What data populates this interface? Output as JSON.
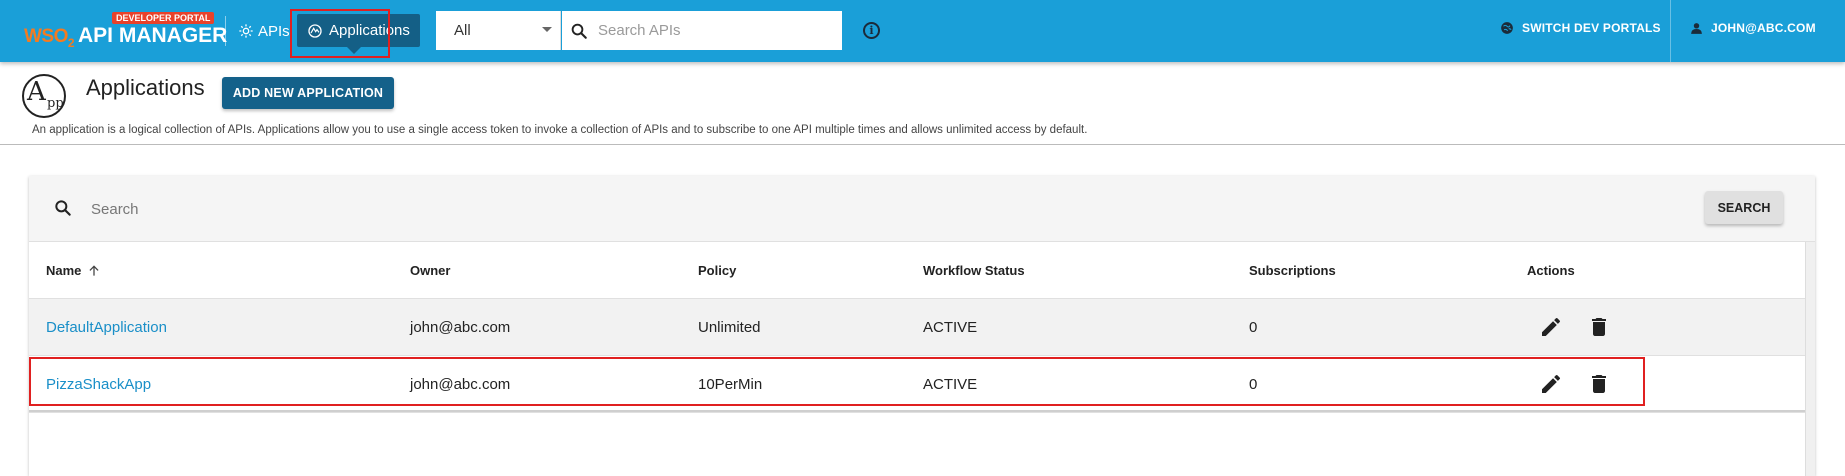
{
  "header": {
    "logo_prefix": "WSO",
    "logo_sub": "2",
    "logo_title": "API MANAGER",
    "badge": "DEVELOPER PORTAL",
    "nav": {
      "apis_label": "APIs",
      "applications_label": "Applications"
    },
    "search": {
      "scope_selected": "All",
      "placeholder": "Search APIs"
    },
    "info_glyph": "i",
    "switch_portals_label": "SWITCH DEV PORTALS",
    "user_label": "JOHN@ABC.COM"
  },
  "page": {
    "title": "Applications",
    "add_button_label": "ADD NEW APPLICATION",
    "description": "An application is a logical collection of APIs. Applications allow you to use a single access token to invoke a collection of APIs and to subscribe to one API multiple times and allows unlimited access by default."
  },
  "table": {
    "search_placeholder": "Search",
    "search_button_label": "SEARCH",
    "sort_column": "Name",
    "sort_direction": "ascending",
    "columns": {
      "name": "Name",
      "owner": "Owner",
      "policy": "Policy",
      "workflow_status": "Workflow Status",
      "subscriptions": "Subscriptions",
      "actions": "Actions"
    },
    "rows": [
      {
        "name": "DefaultApplication",
        "owner": "john@abc.com",
        "policy": "Unlimited",
        "workflow_status": "ACTIVE",
        "subscriptions": "0"
      },
      {
        "name": "PizzaShackApp",
        "owner": "john@abc.com",
        "policy": "10PerMin",
        "workflow_status": "ACTIVE",
        "subscriptions": "0"
      }
    ]
  },
  "colors": {
    "header_bg": "#1a9fd8",
    "nav_active_bg": "#145f86",
    "brand_orange": "#f47b20",
    "badge_red": "#e8422a",
    "primary_button": "#14618a",
    "link": "#1a8fc8",
    "highlight_outline": "#e02020"
  },
  "icons": [
    "gear-icon",
    "applications-icon",
    "search-icon",
    "info-icon",
    "globe-icon",
    "person-icon",
    "sort-arrow-up-icon",
    "edit-pencil-icon",
    "delete-trash-icon"
  ]
}
